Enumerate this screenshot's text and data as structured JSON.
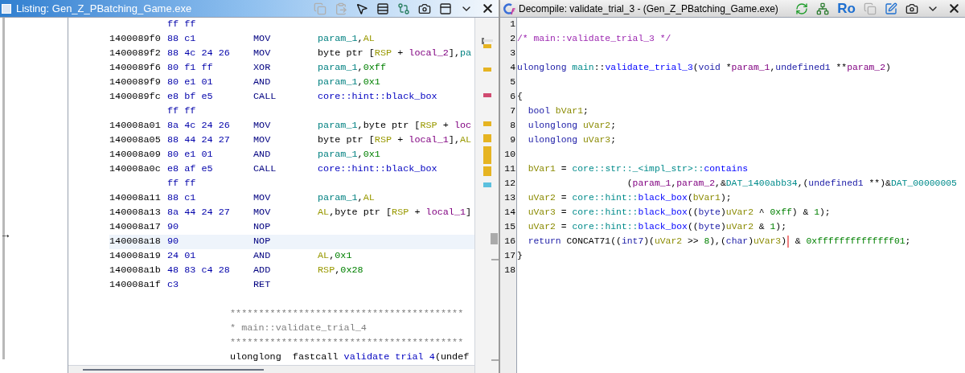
{
  "listing": {
    "title": "Listing:  Gen_Z_PBatching_Game.exe",
    "cursor_arrow": "→",
    "tools": [
      {
        "kind": "copy",
        "disabled": true
      },
      {
        "kind": "paste",
        "disabled": true
      },
      {
        "kind": "select",
        "disabled": false
      },
      {
        "kind": "fields",
        "disabled": false
      },
      {
        "kind": "diff",
        "disabled": false
      },
      {
        "kind": "snapshot",
        "disabled": false
      },
      {
        "kind": "layout",
        "disabled": false
      },
      {
        "kind": "menu",
        "disabled": false
      },
      {
        "kind": "close",
        "disabled": false
      }
    ],
    "rows": [
      {
        "kind": "continuation",
        "bytes": "ff ff",
        "selected": false
      },
      {
        "kind": "instruction",
        "address": "1400089f0",
        "bytes": "88 c1",
        "mnemonic": "MOV",
        "operands": [
          {
            "kind": "var",
            "text": "param_1"
          },
          {
            "kind": "plain",
            "text": ","
          },
          {
            "kind": "reg",
            "text": "AL"
          }
        ],
        "selected": false
      },
      {
        "kind": "instruction",
        "address": "1400089f2",
        "bytes": "88 4c 24 26",
        "mnemonic": "MOV",
        "operands": [
          {
            "kind": "plain",
            "text": "byte ptr ["
          },
          {
            "kind": "reg",
            "text": "RSP"
          },
          {
            "kind": "plain",
            "text": " + "
          },
          {
            "kind": "local",
            "text": "local_2"
          },
          {
            "kind": "plain",
            "text": "],"
          },
          {
            "kind": "var",
            "text": "pa"
          }
        ],
        "selected": false
      },
      {
        "kind": "instruction",
        "address": "1400089f6",
        "bytes": "80 f1 ff",
        "mnemonic": "XOR",
        "operands": [
          {
            "kind": "var",
            "text": "param_1"
          },
          {
            "kind": "plain",
            "text": ","
          },
          {
            "kind": "scalar",
            "text": "0xff"
          }
        ],
        "selected": false
      },
      {
        "kind": "instruction",
        "address": "1400089f9",
        "bytes": "80 e1 01",
        "mnemonic": "AND",
        "operands": [
          {
            "kind": "var",
            "text": "param_1"
          },
          {
            "kind": "plain",
            "text": ","
          },
          {
            "kind": "scalar",
            "text": "0x1"
          }
        ],
        "selected": false
      },
      {
        "kind": "instruction",
        "address": "1400089fc",
        "bytes": "e8 bf e5",
        "mnemonic": "CALL",
        "operands": [
          {
            "kind": "label",
            "text": "core::hint::black_box"
          }
        ],
        "selected": false
      },
      {
        "kind": "continuation",
        "bytes": "ff ff",
        "selected": false
      },
      {
        "kind": "instruction",
        "address": "140008a01",
        "bytes": "8a 4c 24 26",
        "mnemonic": "MOV",
        "operands": [
          {
            "kind": "var",
            "text": "param_1"
          },
          {
            "kind": "plain",
            "text": ",byte ptr ["
          },
          {
            "kind": "reg",
            "text": "RSP"
          },
          {
            "kind": "plain",
            "text": " + "
          },
          {
            "kind": "local",
            "text": "loc"
          }
        ],
        "selected": false
      },
      {
        "kind": "instruction",
        "address": "140008a05",
        "bytes": "88 44 24 27",
        "mnemonic": "MOV",
        "operands": [
          {
            "kind": "plain",
            "text": "byte ptr ["
          },
          {
            "kind": "reg",
            "text": "RSP"
          },
          {
            "kind": "plain",
            "text": " + "
          },
          {
            "kind": "local",
            "text": "local_1"
          },
          {
            "kind": "plain",
            "text": "],"
          },
          {
            "kind": "reg",
            "text": "AL"
          }
        ],
        "selected": false
      },
      {
        "kind": "instruction",
        "address": "140008a09",
        "bytes": "80 e1 01",
        "mnemonic": "AND",
        "operands": [
          {
            "kind": "var",
            "text": "param_1"
          },
          {
            "kind": "plain",
            "text": ","
          },
          {
            "kind": "scalar",
            "text": "0x1"
          }
        ],
        "selected": false
      },
      {
        "kind": "instruction",
        "address": "140008a0c",
        "bytes": "e8 af e5",
        "mnemonic": "CALL",
        "operands": [
          {
            "kind": "label",
            "text": "core::hint::black_box"
          }
        ],
        "selected": false
      },
      {
        "kind": "continuation",
        "bytes": "ff ff",
        "selected": false
      },
      {
        "kind": "instruction",
        "address": "140008a11",
        "bytes": "88 c1",
        "mnemonic": "MOV",
        "operands": [
          {
            "kind": "var",
            "text": "param_1"
          },
          {
            "kind": "plain",
            "text": ","
          },
          {
            "kind": "reg",
            "text": "AL"
          }
        ],
        "selected": false
      },
      {
        "kind": "instruction",
        "address": "140008a13",
        "bytes": "8a 44 24 27",
        "mnemonic": "MOV",
        "operands": [
          {
            "kind": "reg",
            "text": "AL"
          },
          {
            "kind": "plain",
            "text": ",byte ptr ["
          },
          {
            "kind": "reg",
            "text": "RSP"
          },
          {
            "kind": "plain",
            "text": " + "
          },
          {
            "kind": "local",
            "text": "local_1"
          },
          {
            "kind": "plain",
            "text": "]"
          }
        ],
        "selected": false
      },
      {
        "kind": "instruction",
        "address": "140008a17",
        "bytes": "90",
        "mnemonic": "NOP",
        "selected": false
      },
      {
        "kind": "instruction",
        "address": "140008a18",
        "bytes": "90",
        "mnemonic": "NOP",
        "selected": true
      },
      {
        "kind": "instruction",
        "address": "140008a19",
        "bytes": "24 01",
        "mnemonic": "AND",
        "operands": [
          {
            "kind": "reg",
            "text": "AL"
          },
          {
            "kind": "plain",
            "text": ","
          },
          {
            "kind": "scalar",
            "text": "0x1"
          }
        ],
        "selected": false
      },
      {
        "kind": "instruction",
        "address": "140008a1b",
        "bytes": "48 83 c4 28",
        "mnemonic": "ADD",
        "operands": [
          {
            "kind": "reg",
            "text": "RSP"
          },
          {
            "kind": "plain",
            "text": ","
          },
          {
            "kind": "scalar",
            "text": "0x28"
          }
        ],
        "selected": false
      },
      {
        "kind": "instruction",
        "address": "140008a1f",
        "bytes": "c3",
        "mnemonic": "RET",
        "selected": false
      }
    ],
    "header": {
      "comments": [
        "*****************************************",
        "* main::validate_trial_4",
        "*****************************************"
      ],
      "signature": [
        {
          "kind": "plain",
          "text": "ulonglong  fastcall "
        },
        {
          "kind": "label",
          "text": "validate trial 4"
        },
        {
          "kind": "plain",
          "text": "(undef"
        }
      ]
    }
  },
  "decompile": {
    "title": "Decompile: validate_trial_3 -  (Gen_Z_PBatching_Game.exe)",
    "tools": [
      {
        "kind": "refresh",
        "disabled": false
      },
      {
        "kind": "graph",
        "disabled": false
      },
      {
        "kind": "text",
        "label": "Ro",
        "disabled": false
      },
      {
        "kind": "copy",
        "disabled": true
      },
      {
        "kind": "edit",
        "disabled": false
      },
      {
        "kind": "snapshot",
        "disabled": false
      },
      {
        "kind": "menu",
        "disabled": false
      },
      {
        "kind": "close",
        "disabled": false
      }
    ],
    "lines": [
      {
        "number": "1"
      },
      {
        "number": "2",
        "tokens": [
          {
            "kind": "comment",
            "text": "/* main::validate_trial_3 */"
          }
        ]
      },
      {
        "number": "3"
      },
      {
        "number": "4",
        "tokens": [
          {
            "kind": "keyword",
            "text": "ulonglong "
          },
          {
            "kind": "namespace",
            "text": "main"
          },
          {
            "kind": "plain",
            "text": "::"
          },
          {
            "kind": "function",
            "text": "validate_trial_3"
          },
          {
            "kind": "plain",
            "text": "("
          },
          {
            "kind": "keyword",
            "text": "void"
          },
          {
            "kind": "plain",
            "text": " *"
          },
          {
            "kind": "param",
            "text": "param_1"
          },
          {
            "kind": "plain",
            "text": ","
          },
          {
            "kind": "keyword",
            "text": "undefined1"
          },
          {
            "kind": "plain",
            "text": " **"
          },
          {
            "kind": "param",
            "text": "param_2"
          },
          {
            "kind": "plain",
            "text": ")"
          }
        ]
      },
      {
        "number": "5"
      },
      {
        "number": "6",
        "tokens": [
          {
            "kind": "plain",
            "text": "{"
          }
        ]
      },
      {
        "number": "7",
        "tokens": [
          {
            "kind": "keyword",
            "text": "  bool "
          },
          {
            "kind": "local",
            "text": "bVar1"
          },
          {
            "kind": "plain",
            "text": ";"
          }
        ]
      },
      {
        "number": "8",
        "tokens": [
          {
            "kind": "keyword",
            "text": "  ulonglong "
          },
          {
            "kind": "local",
            "text": "uVar2"
          },
          {
            "kind": "plain",
            "text": ";"
          }
        ]
      },
      {
        "number": "9",
        "tokens": [
          {
            "kind": "keyword",
            "text": "  ulonglong "
          },
          {
            "kind": "local",
            "text": "uVar3"
          },
          {
            "kind": "plain",
            "text": ";"
          }
        ]
      },
      {
        "number": "10"
      },
      {
        "number": "11",
        "tokens": [
          {
            "kind": "local",
            "text": "  bVar1"
          },
          {
            "kind": "plain",
            "text": " = "
          },
          {
            "kind": "namespace",
            "text": "core::str::_<impl_str>::"
          },
          {
            "kind": "function",
            "text": "contains"
          }
        ]
      },
      {
        "number": "12",
        "tokens": [
          {
            "kind": "plain",
            "text": "                    ("
          },
          {
            "kind": "param",
            "text": "param_1"
          },
          {
            "kind": "plain",
            "text": ","
          },
          {
            "kind": "param",
            "text": "param_2"
          },
          {
            "kind": "plain",
            "text": ",&"
          },
          {
            "kind": "global",
            "text": "DAT_1400abb34"
          },
          {
            "kind": "plain",
            "text": ",("
          },
          {
            "kind": "keyword",
            "text": "undefined1"
          },
          {
            "kind": "plain",
            "text": " **)&"
          },
          {
            "kind": "global",
            "text": "DAT_00000005"
          }
        ]
      },
      {
        "number": "13",
        "tokens": [
          {
            "kind": "local",
            "text": "  uVar2"
          },
          {
            "kind": "plain",
            "text": " = "
          },
          {
            "kind": "namespace",
            "text": "core::hint::"
          },
          {
            "kind": "function",
            "text": "black_box"
          },
          {
            "kind": "plain",
            "text": "("
          },
          {
            "kind": "local",
            "text": "bVar1"
          },
          {
            "kind": "plain",
            "text": ");"
          }
        ]
      },
      {
        "number": "14",
        "tokens": [
          {
            "kind": "local",
            "text": "  uVar3"
          },
          {
            "kind": "plain",
            "text": " = "
          },
          {
            "kind": "namespace",
            "text": "core::hint::"
          },
          {
            "kind": "function",
            "text": "black_box"
          },
          {
            "kind": "plain",
            "text": "(("
          },
          {
            "kind": "keyword",
            "text": "byte"
          },
          {
            "kind": "plain",
            "text": ")"
          },
          {
            "kind": "local",
            "text": "uVar2"
          },
          {
            "kind": "plain",
            "text": " ^ "
          },
          {
            "kind": "const",
            "text": "0xff"
          },
          {
            "kind": "plain",
            "text": ") & "
          },
          {
            "kind": "const",
            "text": "1"
          },
          {
            "kind": "plain",
            "text": ");"
          }
        ]
      },
      {
        "number": "15",
        "tokens": [
          {
            "kind": "local",
            "text": "  uVar2"
          },
          {
            "kind": "plain",
            "text": " = "
          },
          {
            "kind": "namespace",
            "text": "core::hint::"
          },
          {
            "kind": "function",
            "text": "black_box"
          },
          {
            "kind": "plain",
            "text": "(("
          },
          {
            "kind": "keyword",
            "text": "byte"
          },
          {
            "kind": "plain",
            "text": ")"
          },
          {
            "kind": "local",
            "text": "uVar2"
          },
          {
            "kind": "plain",
            "text": " & "
          },
          {
            "kind": "const",
            "text": "1"
          },
          {
            "kind": "plain",
            "text": ");"
          }
        ]
      },
      {
        "number": "16",
        "tokens": [
          {
            "kind": "keyword",
            "text": "  return"
          },
          {
            "kind": "plain",
            "text": " CONCAT71(("
          },
          {
            "kind": "keyword",
            "text": "int7"
          },
          {
            "kind": "plain",
            "text": ")("
          },
          {
            "kind": "local",
            "text": "uVar2"
          },
          {
            "kind": "plain",
            "text": " >> "
          },
          {
            "kind": "const",
            "text": "8"
          },
          {
            "kind": "plain",
            "text": "),("
          },
          {
            "kind": "keyword",
            "text": "char"
          },
          {
            "kind": "plain",
            "text": ")"
          },
          {
            "kind": "local",
            "text": "uVar3"
          },
          {
            "kind": "plain",
            "text": ")",
            "cursor": true
          },
          {
            "kind": "plain",
            "text": " & "
          },
          {
            "kind": "const",
            "text": "0xffffffffffffff01"
          },
          {
            "kind": "plain",
            "text": ";"
          }
        ]
      },
      {
        "number": "17",
        "tokens": [
          {
            "kind": "plain",
            "text": "}"
          }
        ]
      },
      {
        "number": "18"
      }
    ]
  }
}
